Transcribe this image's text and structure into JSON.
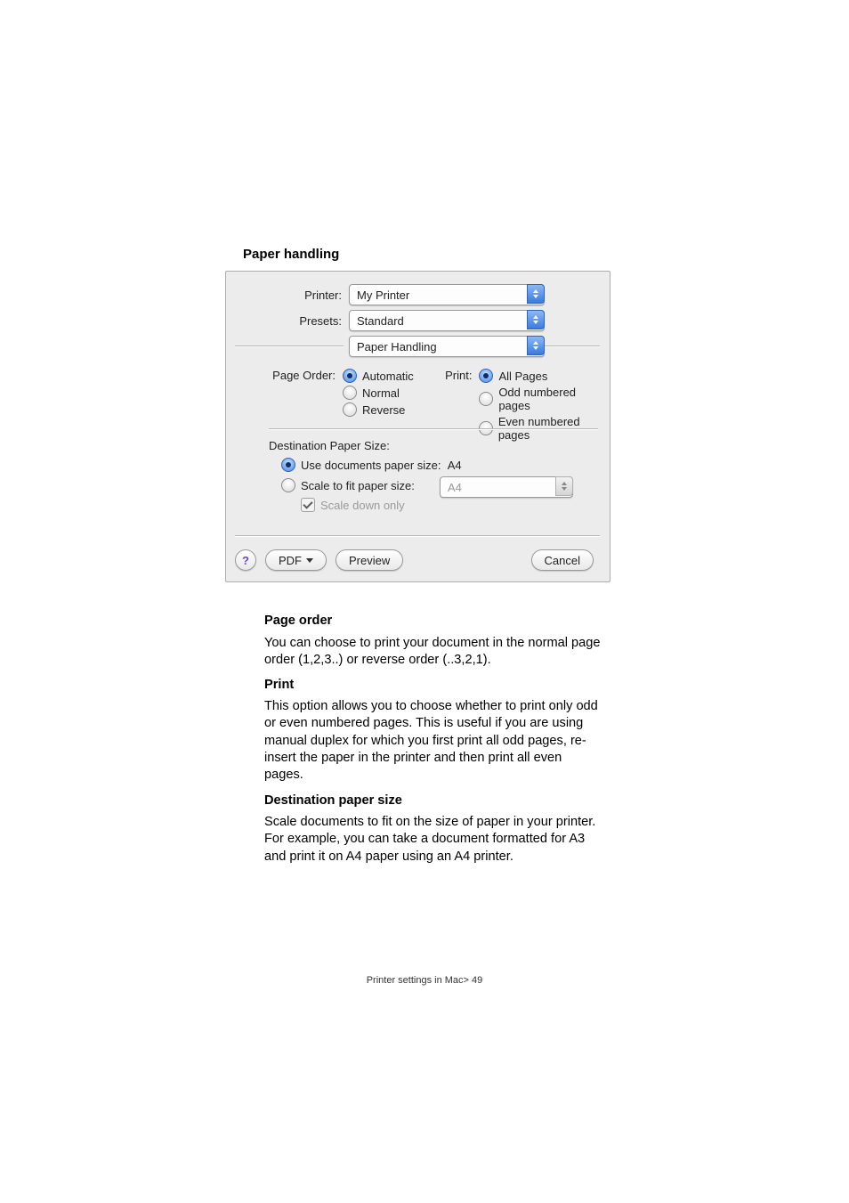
{
  "section_title": "Paper handling",
  "dialog": {
    "printer_label": "Printer:",
    "printer_value": "My Printer",
    "presets_label": "Presets:",
    "presets_value": "Standard",
    "panel_value": "Paper Handling",
    "page_order": {
      "label": "Page Order:",
      "options": {
        "automatic": "Automatic",
        "normal": "Normal",
        "reverse": "Reverse"
      }
    },
    "print": {
      "label": "Print:",
      "options": {
        "all": "All Pages",
        "odd": "Odd numbered pages",
        "even": "Even numbered pages"
      }
    },
    "destination": {
      "label": "Destination Paper Size:",
      "use_doc_prefix": "Use documents paper size:",
      "use_doc_value": "A4",
      "scale_to_fit": "Scale to fit paper size:",
      "scale_value": "A4",
      "scale_down_only": "Scale down only"
    },
    "buttons": {
      "help": "?",
      "pdf": "PDF",
      "preview": "Preview",
      "cancel": "Cancel"
    }
  },
  "doc": {
    "page_order_h": "Page order",
    "page_order_p": "You can choose to print your document in the normal page order (1,2,3..) or reverse order (..3,2,1).",
    "print_h": "Print",
    "print_p": "This option allows you to choose whether to print only odd or even numbered pages. This is useful if you are using manual duplex for which you first print all odd pages, re-insert the paper in the printer and then print all even pages.",
    "dest_h": "Destination paper size",
    "dest_p": "Scale documents to fit on the size of paper in your printer. For example, you can take a document formatted for A3 and print it on A4 paper using an A4 printer."
  },
  "footer": "Printer settings in Mac> 49"
}
